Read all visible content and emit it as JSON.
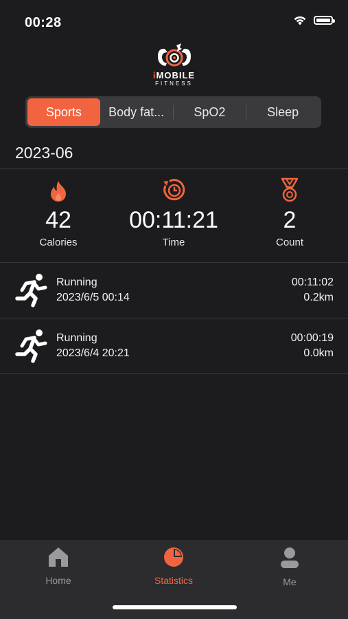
{
  "status_bar": {
    "time": "00:28"
  },
  "logo": {
    "line1_prefix": "i",
    "line1": "MOBILE",
    "line2": "FITNESS"
  },
  "segments": [
    {
      "label": "Sports",
      "active": true
    },
    {
      "label": "Body fat...",
      "active": false
    },
    {
      "label": "SpO2",
      "active": false
    },
    {
      "label": "Sleep",
      "active": false
    }
  ],
  "month": "2023-06",
  "summary": {
    "calories": {
      "value": "42",
      "label": "Calories",
      "icon": "flame-icon"
    },
    "time": {
      "value": "00:11:21",
      "label": "Time",
      "icon": "timer-icon"
    },
    "count": {
      "value": "2",
      "label": "Count",
      "icon": "medal-icon"
    }
  },
  "activities": [
    {
      "name": "Running",
      "date": "2023/6/5 00:14",
      "duration": "00:11:02",
      "distance": "0.2km",
      "icon": "runner-icon"
    },
    {
      "name": "Running",
      "date": "2023/6/4 20:21",
      "duration": "00:00:19",
      "distance": "0.0km",
      "icon": "runner-icon"
    }
  ],
  "tabbar": {
    "home": {
      "label": "Home",
      "icon": "home-icon"
    },
    "statistics": {
      "label": "Statistics",
      "icon": "pie-chart-icon",
      "active": true
    },
    "me": {
      "label": "Me",
      "icon": "person-icon"
    }
  },
  "colors": {
    "accent": "#f26440",
    "background": "#1c1c1e",
    "tabbar": "#2c2c2e",
    "segment": "#3a3a3c",
    "inactive_tab": "#9a9a9e"
  }
}
